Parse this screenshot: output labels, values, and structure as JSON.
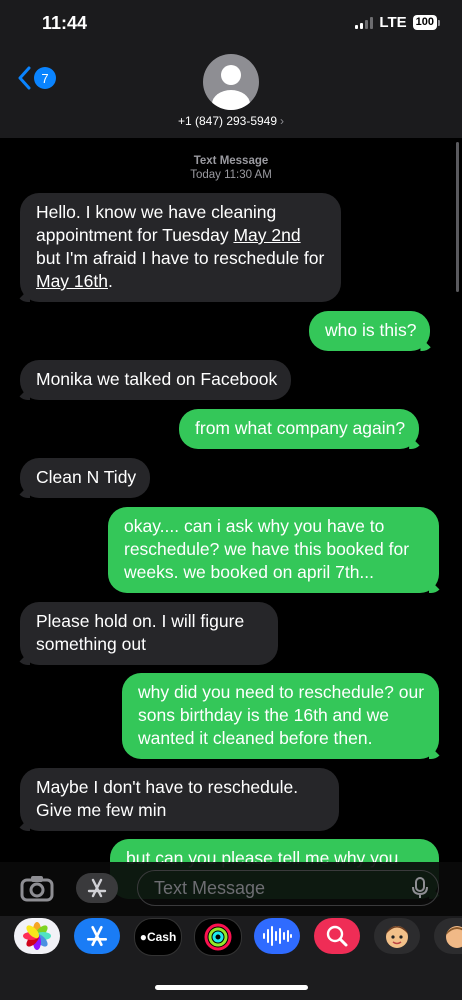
{
  "status_bar": {
    "time": "11:44",
    "network": "LTE",
    "battery": "100"
  },
  "header": {
    "back_count": "7",
    "contact": "+1 (847) 293-5949"
  },
  "thread": {
    "label": "Text Message",
    "timestamp": "Today 11:30 AM"
  },
  "messages": [
    {
      "dir": "in",
      "parts": [
        "Hello. I know we have cleaning appointment for Tuesday ",
        "May 2nd",
        " but I'm afraid I have to reschedule for ",
        "May 16th",
        "."
      ]
    },
    {
      "dir": "out",
      "text": "who is this?"
    },
    {
      "dir": "in",
      "text": "Monika we talked on Facebook"
    },
    {
      "dir": "out",
      "text": "from what company again?"
    },
    {
      "dir": "in",
      "text": "Clean N Tidy"
    },
    {
      "dir": "out",
      "text": "okay.... can i ask why you have to reschedule? we have this booked for weeks. we booked on april 7th..."
    },
    {
      "dir": "in",
      "text": "Please hold on. I will figure something out"
    },
    {
      "dir": "out",
      "text": "why did you need to reschedule? our sons birthday is the 16th and we wanted it cleaned before then."
    },
    {
      "dir": "in",
      "text": "Maybe I don't have to reschedule. Give me few min"
    },
    {
      "dir": "out",
      "text": "but can you please tell me why you"
    }
  ],
  "compose": {
    "placeholder": "Text Message"
  },
  "app_drawer": {
    "apps": [
      {
        "name": "photos-app",
        "icon": "photos-icon"
      },
      {
        "name": "app-store-app",
        "icon": "app-store-icon"
      },
      {
        "name": "apple-cash-app",
        "icon": "apple-cash-icon",
        "label": "Cash"
      },
      {
        "name": "fitness-app",
        "icon": "activity-rings-icon"
      },
      {
        "name": "audio-message-app",
        "icon": "waveform-icon"
      },
      {
        "name": "image-search-app",
        "icon": "globe-search-icon"
      },
      {
        "name": "memoji-app",
        "icon": "memoji-icon"
      },
      {
        "name": "memoji-app-2",
        "icon": "memoji-icon"
      }
    ]
  },
  "colors": {
    "incoming": "#262629",
    "outgoing": "#34c759",
    "accent": "#0a84ff"
  }
}
